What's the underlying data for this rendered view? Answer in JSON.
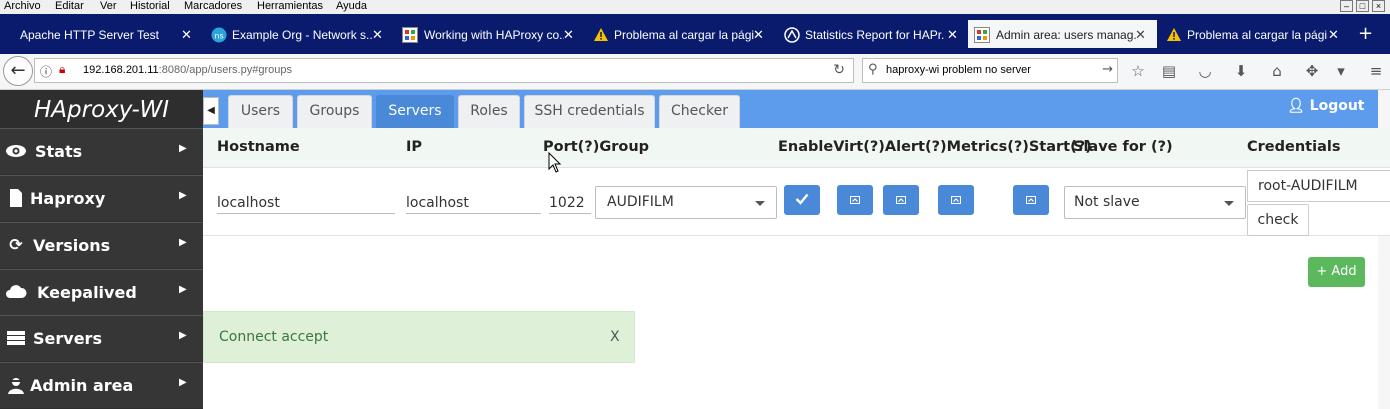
{
  "menubar": {
    "items": [
      "Archivo",
      "Editar",
      "Ver",
      "Historial",
      "Marcadores",
      "Herramientas",
      "Ayuda"
    ]
  },
  "tabs": [
    {
      "label": "Apache HTTP Server Test Pag...",
      "icon": "apache-icon"
    },
    {
      "label": "Example Org - Network s...",
      "icon": "network-icon"
    },
    {
      "label": "Working with HAProxy co...",
      "icon": "site-icon"
    },
    {
      "label": "Problema al cargar la pági...",
      "icon": "warning-icon"
    },
    {
      "label": "Statistics Report for HAPr...",
      "icon": "haproxy-icon"
    },
    {
      "label": "Admin area: users manag...",
      "icon": "site-icon",
      "active": true
    },
    {
      "label": "Problema al cargar la pági...",
      "icon": "warning-icon"
    }
  ],
  "close_glyph": "✕",
  "newtab_glyph": "+",
  "navbar": {
    "url_host": "192.168.201.11",
    "url_path": ":8080/app/users.py#groups",
    "search_text": "haproxy-wi problem no server"
  },
  "sidebar": {
    "brand": "HAproxy-WI",
    "items": [
      {
        "label": "Stats",
        "icon": "eye-icon"
      },
      {
        "label": "Haproxy",
        "icon": "file-icon"
      },
      {
        "label": "Versions",
        "icon": "refresh-icon"
      },
      {
        "label": "Keepalived",
        "icon": "cloud-icon"
      },
      {
        "label": "Servers",
        "icon": "server-icon"
      },
      {
        "label": "Admin area",
        "icon": "user-secret-icon"
      }
    ]
  },
  "content_tabs": [
    {
      "label": "Users"
    },
    {
      "label": "Groups"
    },
    {
      "label": "Servers",
      "active": true
    },
    {
      "label": "Roles"
    },
    {
      "label": "SSH credentials"
    },
    {
      "label": "Checker"
    }
  ],
  "logout_label": "Logout",
  "table": {
    "headers": {
      "hostname": "Hostname",
      "ip": "IP",
      "port_group": "Port(?)Group",
      "flags": "EnableVirt(?)Alert(?)Metrics(?)Start(?)",
      "slave": "Slave for (?)",
      "credentials": "Credentials"
    },
    "row": {
      "hostname": "localhost",
      "ip": "localhost",
      "port": "1022",
      "group": "AUDIFILM",
      "enable": true,
      "virt": false,
      "alert": false,
      "metrics": false,
      "start": false,
      "slave": "Not slave",
      "credentials": "root-AUDIFILM",
      "check_label": "check"
    }
  },
  "add_label": "+ Add",
  "alert": {
    "message": "Connect accept",
    "close": "X"
  },
  "colors": {
    "header_blue": "#5d9cec",
    "active_tab": "#4a88d8",
    "sidebar": "#2e2e2e",
    "success": "#5cb85c",
    "tabbar": "#0a1b6e"
  }
}
